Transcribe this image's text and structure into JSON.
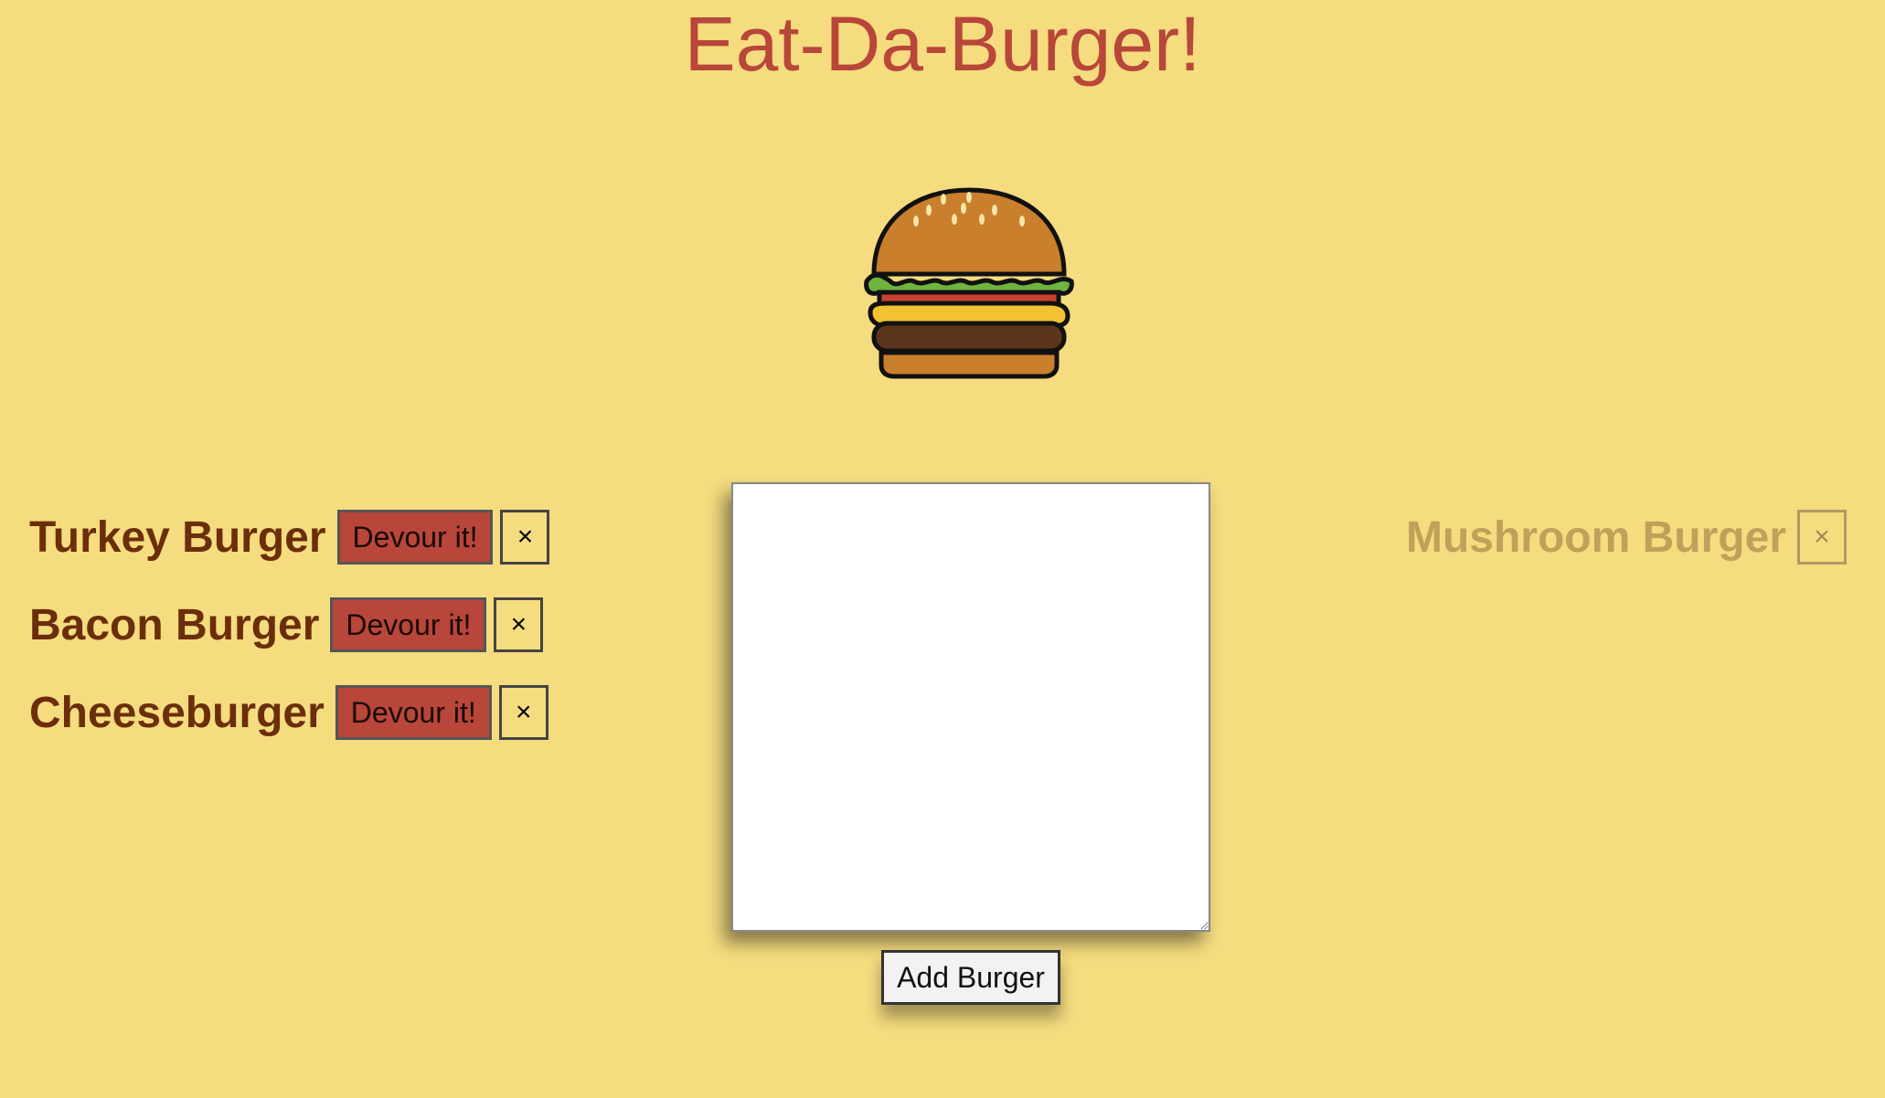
{
  "header": {
    "title": "Eat-Da-Burger!"
  },
  "logo": {
    "icon": "hamburger-icon"
  },
  "uneaten": [
    {
      "name": "Turkey Burger",
      "devour_label": "Devour it!",
      "delete_label": "×"
    },
    {
      "name": "Bacon Burger",
      "devour_label": "Devour it!",
      "delete_label": "×"
    },
    {
      "name": "Cheeseburger",
      "devour_label": "Devour it!",
      "delete_label": "×"
    }
  ],
  "devoured": [
    {
      "name": "Mushroom Burger",
      "delete_label": "×"
    }
  ],
  "form": {
    "textarea_value": "",
    "add_label": "Add Burger"
  },
  "colors": {
    "background": "#f5dc7f",
    "title": "#b8463a",
    "burger_name": "#6b2e0b",
    "devoured_name": "#c1a05a",
    "devour_button": "#b8463a"
  }
}
